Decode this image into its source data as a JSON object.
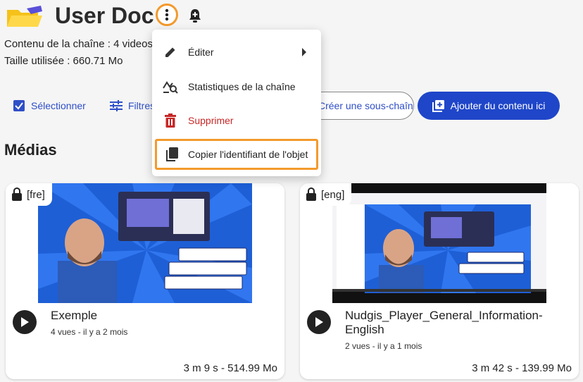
{
  "header": {
    "title": "User Doc"
  },
  "info": {
    "content_line": "Contenu de la chaîne :  4 videos",
    "size_line": "Taille utilisée : 660.71 Mo"
  },
  "actions": {
    "select_label": "Sélectionner",
    "filter_label": "Filtres",
    "subchannel_label": "Créer une sous-chaîne",
    "add_label": "Ajouter du contenu ici"
  },
  "section": {
    "title": "Médias"
  },
  "menu": {
    "items": [
      {
        "label": "Éditer",
        "icon": "pencil-icon"
      },
      {
        "label": "Statistiques de la chaîne",
        "icon": "stats-icon"
      },
      {
        "label": "Supprimer",
        "icon": "trash-icon"
      },
      {
        "label": "Copier l'identifiant de l'objet",
        "icon": "copy-icon"
      }
    ]
  },
  "media": [
    {
      "lang": "[fre]",
      "duration": "3 m 9 s - 514.99 Mo",
      "title": "Exemple",
      "views": "4 vues",
      "date": "il y a 2 mois"
    },
    {
      "lang": "[eng]",
      "duration": "3 m 42 s - 139.99 Mo",
      "title": "Nudgis_Player_General_Information-English",
      "views": "2 vues",
      "date": "il y a 1 mois"
    }
  ],
  "colors": {
    "accent": "#1f46c9",
    "link": "#2f4fc8",
    "highlight": "#f39a2c",
    "danger": "#c62828"
  }
}
